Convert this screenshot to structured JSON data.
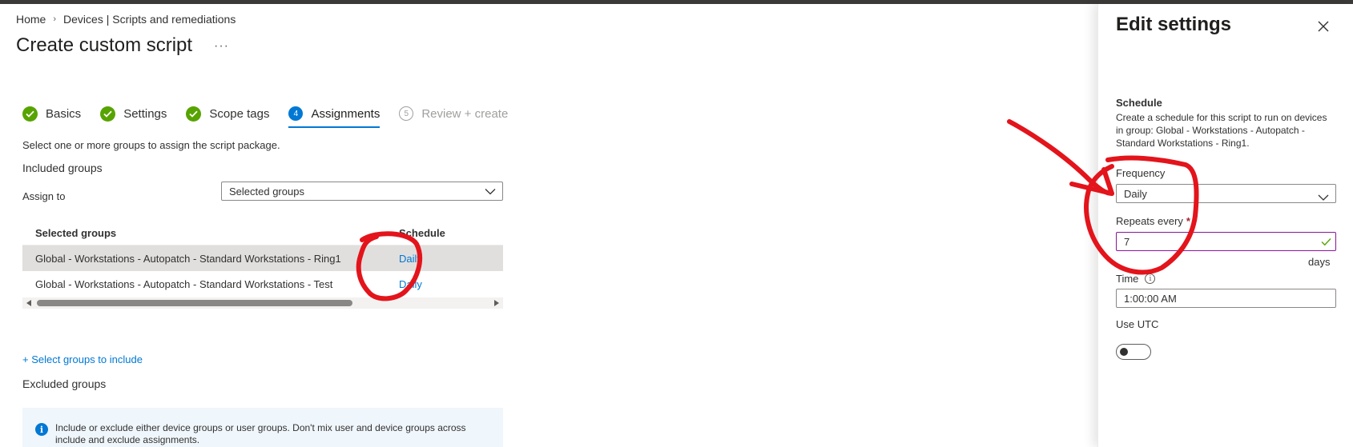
{
  "breadcrumb": {
    "home": "Home",
    "section": "Devices | Scripts and remediations"
  },
  "page": {
    "title": "Create custom script",
    "more": "···"
  },
  "wizard": {
    "steps": [
      {
        "label": "Basics",
        "state": "done"
      },
      {
        "label": "Settings",
        "state": "done"
      },
      {
        "label": "Scope tags",
        "state": "done"
      },
      {
        "label": "Assignments",
        "state": "current",
        "number": "4"
      },
      {
        "label": "Review + create",
        "state": "future",
        "number": "5"
      }
    ]
  },
  "assignments": {
    "instruction": "Select one or more groups to assign the script package.",
    "included_title": "Included groups",
    "assign_to_label": "Assign to",
    "assign_to_value": "Selected groups",
    "table": {
      "headers": [
        "Selected groups",
        "Schedule"
      ],
      "rows": [
        {
          "group": "Global - Workstations - Autopatch - Standard Workstations - Ring1",
          "schedule": "Daily"
        },
        {
          "group": "Global - Workstations - Autopatch - Standard Workstations - Test",
          "schedule": "Daily"
        }
      ]
    },
    "select_groups_link": "+ Select groups to include",
    "excluded_title": "Excluded groups",
    "info_text": "Include or exclude either device groups or user groups. Don't mix user and device groups across include and exclude assignments."
  },
  "panel": {
    "title": "Edit settings",
    "schedule_title": "Schedule",
    "schedule_desc": "Create a schedule for this script to run on devices in group: Global - Workstations - Autopatch - Standard Workstations - Ring1.",
    "frequency_label": "Frequency",
    "frequency_value": "Daily",
    "repeats_label": "Repeats every",
    "required_mark": "*",
    "repeats_value": "7",
    "repeats_unit": "days",
    "time_label": "Time",
    "time_value": "1:00:00 AM",
    "utc_label": "Use UTC",
    "utc_enabled": false
  },
  "colors": {
    "accent": "#0078d4",
    "success": "#57a300",
    "annotation": "#e3141b",
    "focus_border": "#881798"
  }
}
